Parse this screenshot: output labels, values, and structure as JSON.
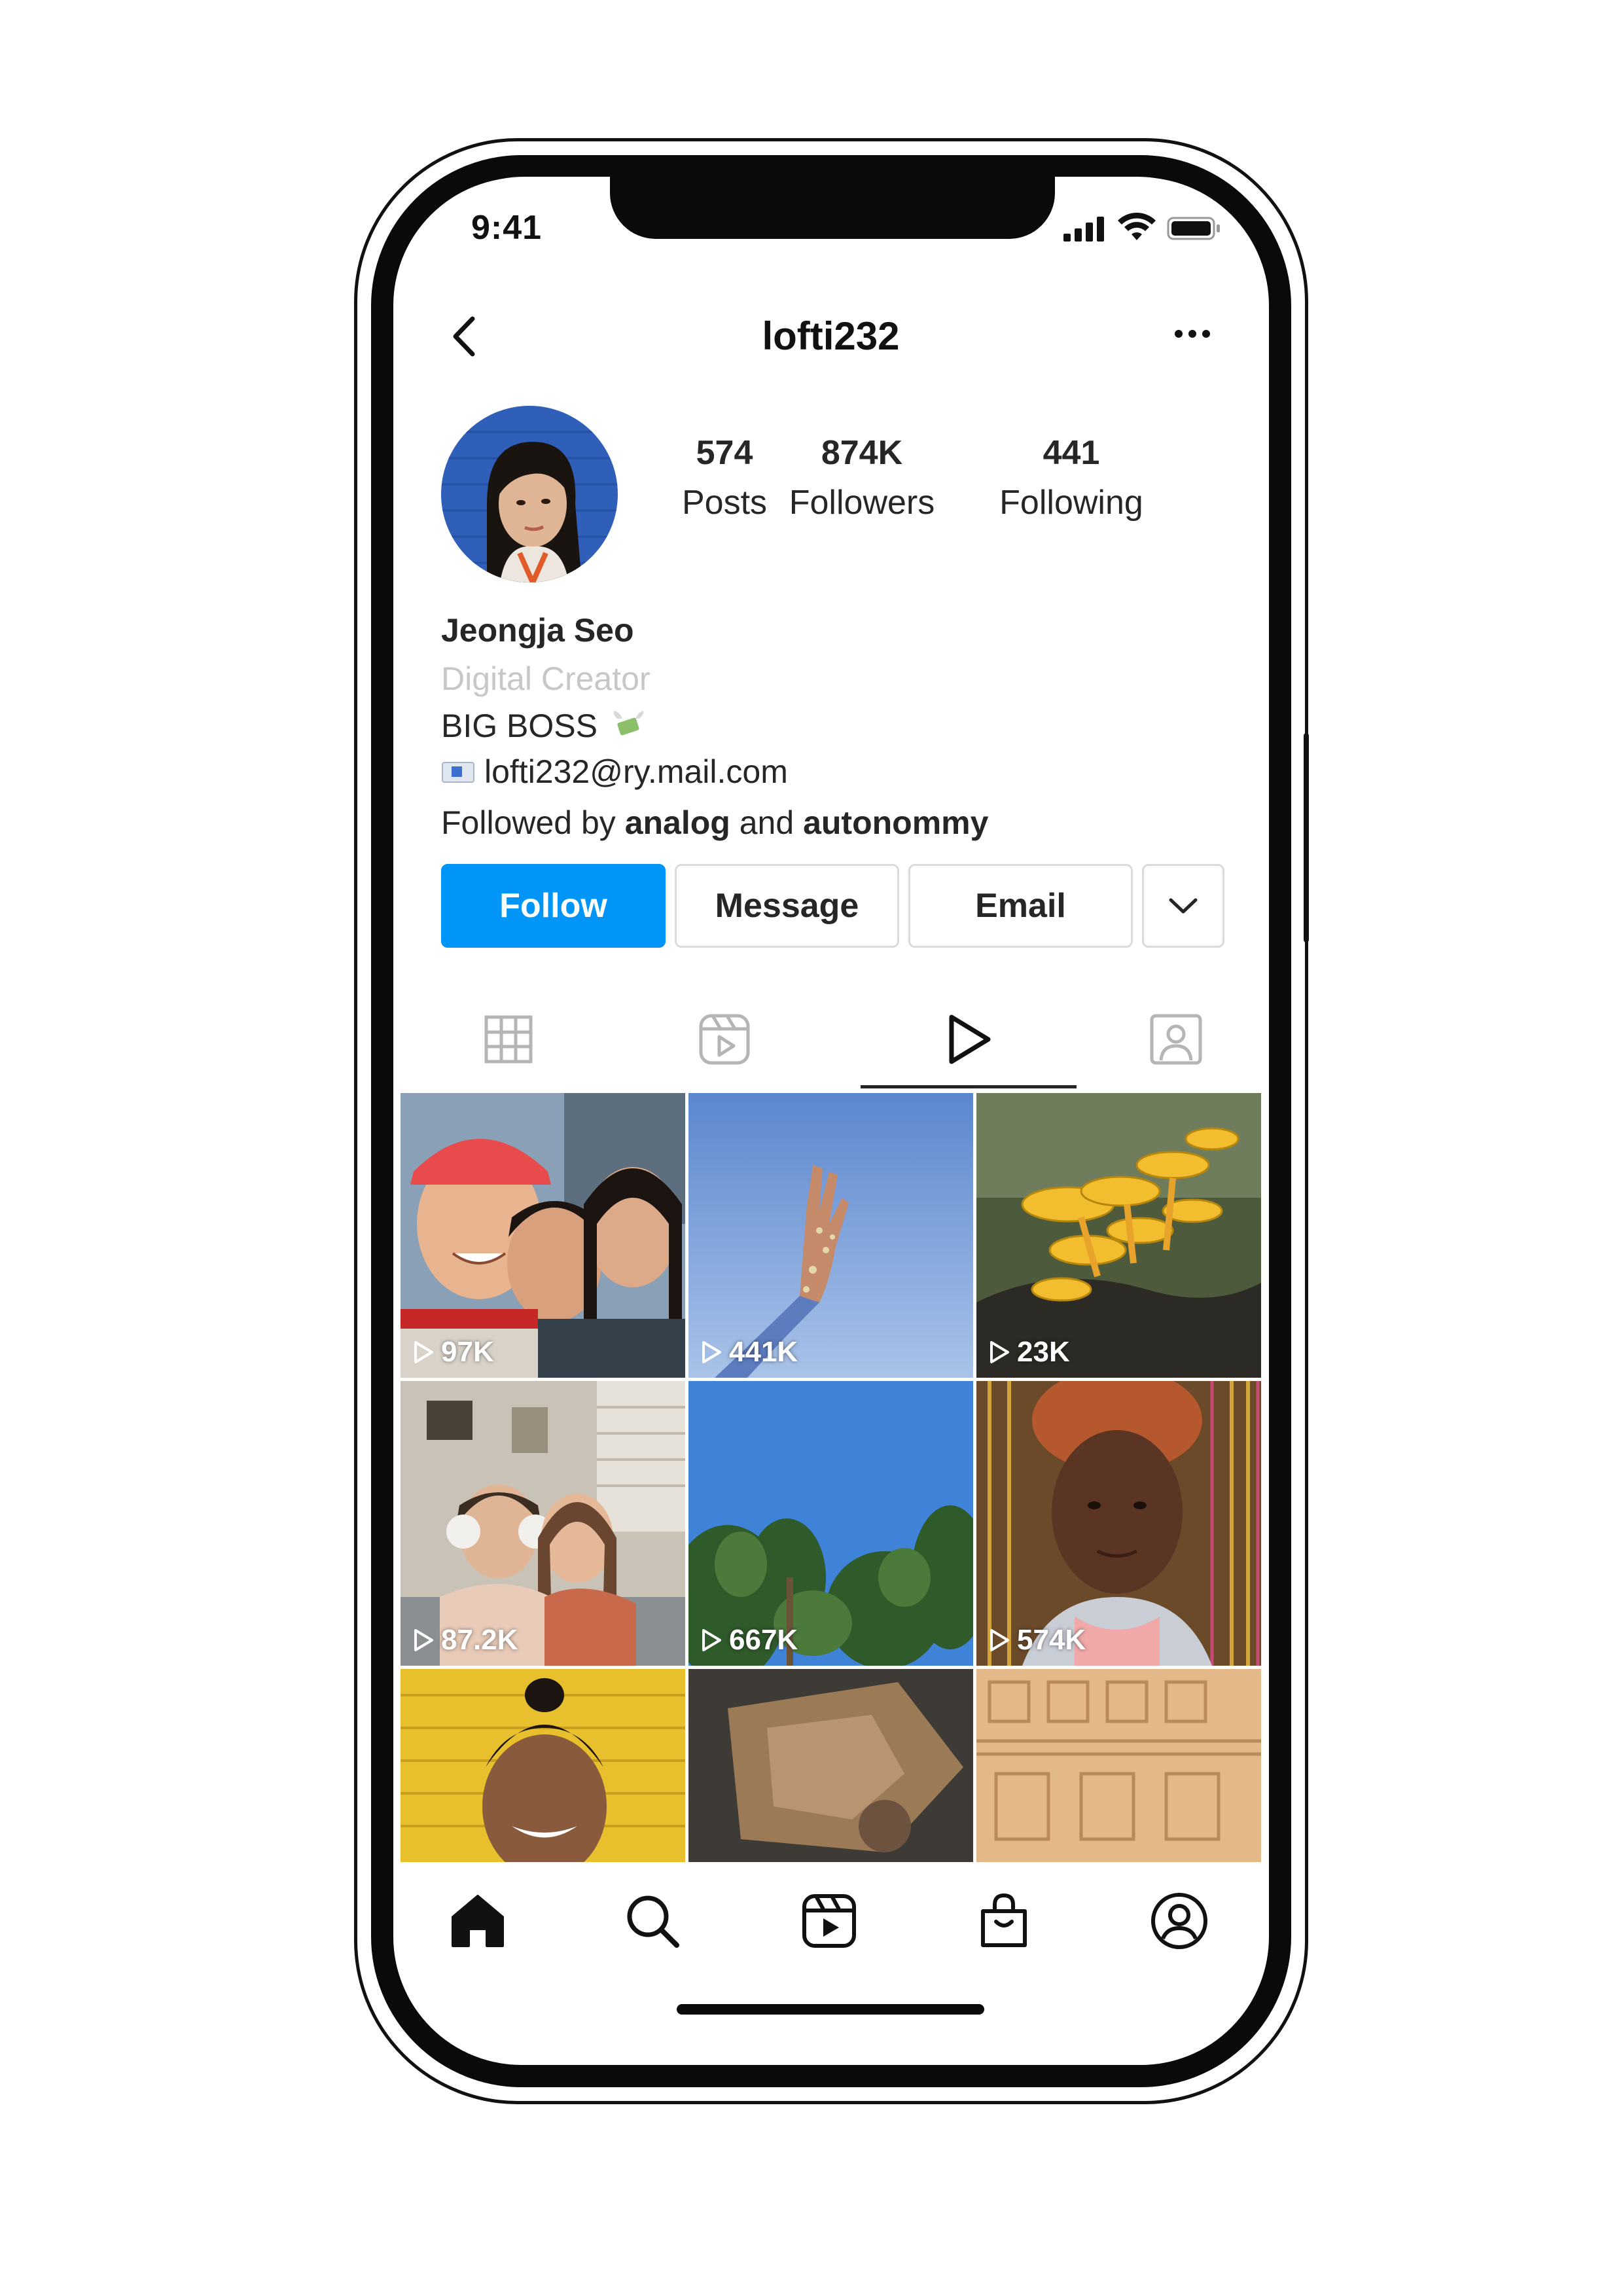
{
  "status_bar": {
    "time": "9:41"
  },
  "header": {
    "username": "lofti232"
  },
  "profile": {
    "stats": [
      {
        "value": "574",
        "label": "Posts"
      },
      {
        "value": "874K",
        "label": "Followers"
      },
      {
        "value": "441",
        "label": "Following"
      }
    ],
    "name": "Jeongja Seo",
    "category": "Digital Creator",
    "bio_line": "BIG BOSS",
    "email": "lofti232@ry.mail.com",
    "followed_by_prefix": "Followed by ",
    "followed_by_user1": "analog",
    "followed_by_and": " and ",
    "followed_by_user2": "autonommy"
  },
  "actions": {
    "follow_label": "Follow",
    "message_label": "Message",
    "email_label": "Email"
  },
  "tabs": [
    "grid-icon",
    "reels-icon",
    "video-play-icon",
    "tagged-icon"
  ],
  "selected_tab": 2,
  "grid": [
    {
      "views": "97K"
    },
    {
      "views": "441K"
    },
    {
      "views": "23K"
    },
    {
      "views": "87.2K"
    },
    {
      "views": "667K"
    },
    {
      "views": "574K"
    },
    {
      "views": ""
    },
    {
      "views": ""
    },
    {
      "views": ""
    }
  ],
  "bottom_nav": [
    "home-icon",
    "search-icon",
    "reels-icon",
    "shop-icon",
    "profile-icon"
  ],
  "colors": {
    "accent": "#0095f6",
    "text": "#262626",
    "muted": "#c7c7c7"
  }
}
